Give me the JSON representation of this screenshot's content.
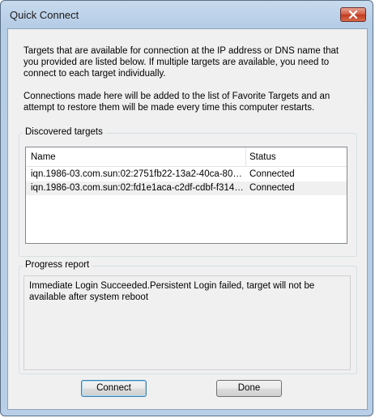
{
  "window": {
    "title": "Quick Connect"
  },
  "description": {
    "paragraph1": "Targets that are available for connection at the IP address or DNS name that you provided are listed below.  If multiple targets are available, you need to connect to each target individually.",
    "paragraph2": "Connections made here will be added to the list of Favorite Targets and an attempt to restore them will be made every time this computer restarts."
  },
  "discovered": {
    "label": "Discovered targets",
    "columns": [
      "Name",
      "Status"
    ],
    "rows": [
      {
        "name": "iqn.1986-03.com.sun:02:2751fb22-13a2-40ca-80ac...",
        "status": "Connected"
      },
      {
        "name": "iqn.1986-03.com.sun:02:fd1e1aca-c2df-cdbf-f314-...",
        "status": "Connected"
      }
    ]
  },
  "progress": {
    "label": "Progress report",
    "text": "Immediate Login Succeeded.Persistent Login failed, target will not be available after system reboot"
  },
  "buttons": {
    "connect": "Connect",
    "done": "Done"
  },
  "icons": {
    "close": "close-icon"
  }
}
